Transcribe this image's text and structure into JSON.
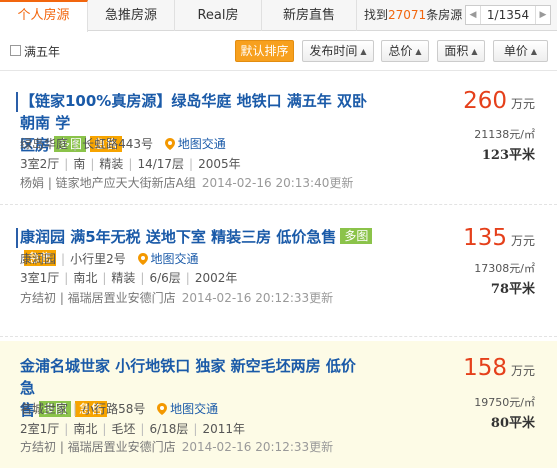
{
  "tabs": [
    {
      "label": "个人房源",
      "active": true
    },
    {
      "label": "急推房源",
      "active": false
    },
    {
      "label": "Real房",
      "active": false
    },
    {
      "label": "新房直售",
      "active": false
    }
  ],
  "result": {
    "prefix": "找到",
    "count": "27071",
    "suffix": "条房源"
  },
  "pager": {
    "page": "1/1354",
    "prev_icon": "chevron-left-icon",
    "next_icon": "chevron-right-icon"
  },
  "filter": {
    "five_years_label": "满五年",
    "five_years_checked": false
  },
  "sort": {
    "default": "默认排序",
    "time": "发布时间",
    "total": "总价",
    "area": "面积",
    "unit": "单价"
  },
  "colors": {
    "accent": "#f2660e",
    "title": "#1a5aa8",
    "price": "#e5401b",
    "tag_multi": "#8bc34a",
    "tag_urgent": "#f7a400"
  },
  "listings": [
    {
      "title_line1": "【链家100%真房源】绿岛华庭 地铁口 满五年 双卧朝南 学",
      "title_line2": "区房",
      "tag_multi": "多图",
      "tag_urgent": "急售",
      "community": "绿岛华庭",
      "address": "长虹路443号",
      "map_label": "地图交通",
      "layout": "3室2厅",
      "orientation": "南",
      "decor": "精装",
      "floor": "14/17层",
      "year": "2005年",
      "agent": "杨娟 | 链家地产应天大街新店A组",
      "updated": "2014-02-16 20:13:40更新",
      "price": "260",
      "price_unit": "万元",
      "unit_price": "21138元/㎡",
      "area": "123平米"
    },
    {
      "title_line1": "康润园 满5年无税 送地下室 精装三房 低价急售",
      "tag_multi": "多图",
      "tag_urgent": "急售",
      "community": "康润园",
      "address": "小行里2号",
      "map_label": "地图交通",
      "layout": "3室1厅",
      "orientation": "南北",
      "decor": "精装",
      "floor": "6/6层",
      "year": "2002年",
      "agent": "方结初 | 福瑞居置业安德门店",
      "updated": "2014-02-16 20:12:33更新",
      "price": "135",
      "price_unit": "万元",
      "unit_price": "17308元/㎡",
      "area": "78平米"
    },
    {
      "title_line1": "金浦名城世家 小行地铁口 独家 新空毛坯两房 低价急",
      "title_line2": "售",
      "tag_multi": "多图",
      "tag_urgent": "急售",
      "community": "名城世家",
      "address": "小行路58号",
      "map_label": "地图交通",
      "layout": "2室1厅",
      "orientation": "南北",
      "decor": "毛坯",
      "floor": "6/18层",
      "year": "2011年",
      "agent": "方结初 | 福瑞居置业安德门店",
      "updated": "2014-02-16 20:12:33更新",
      "price": "158",
      "price_unit": "万元",
      "unit_price": "19750元/㎡",
      "area": "80平米"
    }
  ]
}
